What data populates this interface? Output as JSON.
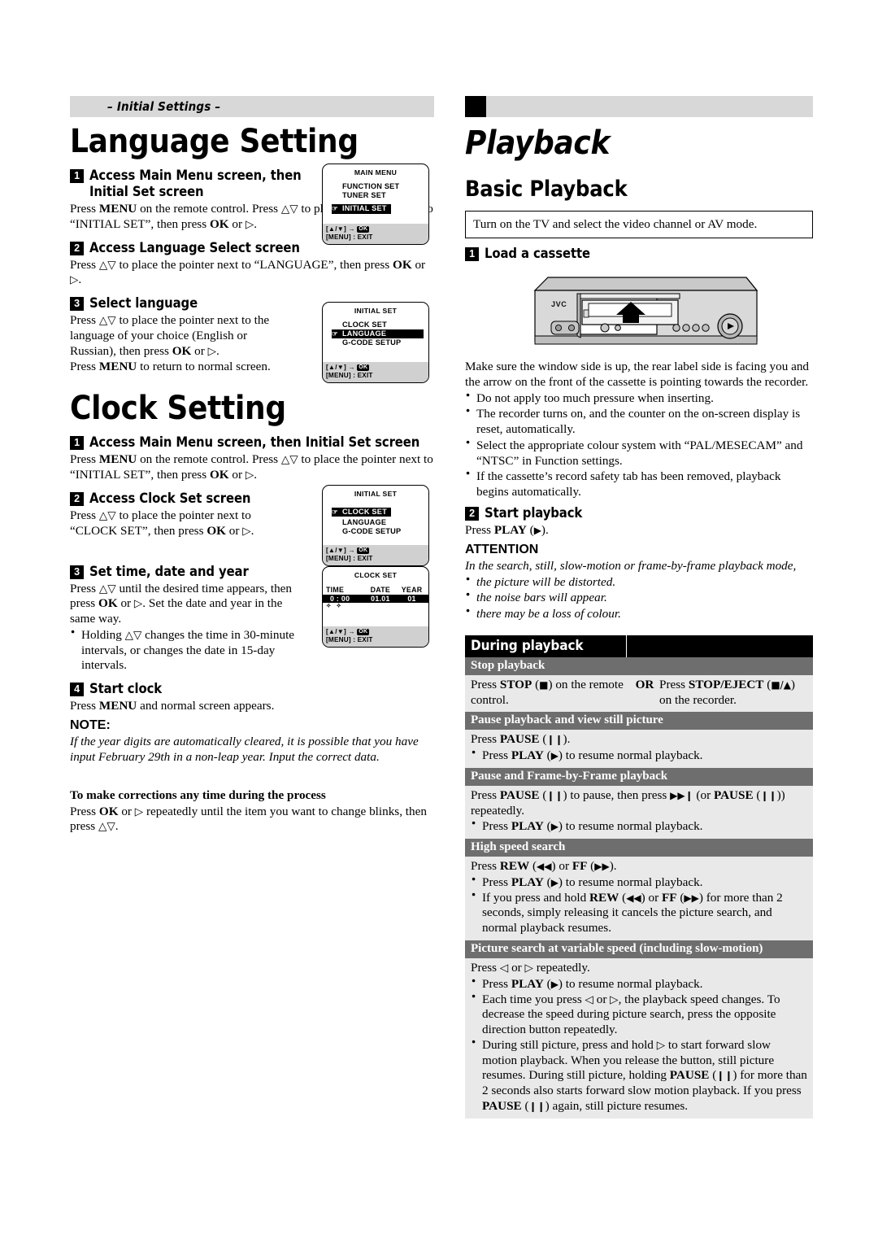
{
  "left": {
    "running_head": "– Initial Settings –",
    "chapter_title": "Language Setting",
    "lang_steps": [
      {
        "num": "1",
        "title_line1": "Access Main Menu screen, then",
        "title_line2": "Initial Set screen",
        "body": "Press MENU on the remote control. Press △▽ to place the pointer next to “INITIAL SET”, then press OK or ▷."
      },
      {
        "num": "2",
        "title_line1": "Access Language Select screen",
        "body": "Press △▽ to place the pointer next to “LANGUAGE”, then press OK or ▷."
      },
      {
        "num": "3",
        "title_line1": "Select language",
        "body": "Press △▽ to place the pointer next to the language of your choice (English or Russian), then press OK or ▷.",
        "body2": "Press MENU to return to normal screen."
      }
    ],
    "clock_title": "Clock Setting",
    "clock_steps": [
      {
        "num": "1",
        "title_line1": "Access Main Menu screen, then Initial Set screen",
        "body": "Press MENU on the remote control. Press △▽ to place the pointer next to “INITIAL SET”, then press OK or ▷."
      },
      {
        "num": "2",
        "title_line1": "Access Clock Set screen",
        "body": "Press △▽ to place the pointer next to “CLOCK SET”, then press OK or ▷."
      },
      {
        "num": "3",
        "title_line1": "Set time, date and year",
        "body": "Press △▽ until the desired time appears, then press OK or ▷. Set the date and year in the same way.",
        "bullets": [
          "Holding △▽ changes the time in 30-minute intervals, or changes the date in 15-day intervals."
        ]
      },
      {
        "num": "4",
        "title_line1": "Start clock",
        "body": "Press MENU and normal screen appears."
      }
    ],
    "note_label": "NOTE:",
    "note_body": "If the year digits are automatically cleared, it is possible that you have input February 29th in a non-leap year. Input the correct data.",
    "corrections_title": "To make corrections any time during the process",
    "corrections_body": "Press OK or ▷ repeatedly until the item you want to change blinks, then press △▽."
  },
  "osd": {
    "main_menu": {
      "title": "MAIN MENU",
      "items": [
        "FUNCTION SET",
        "TUNER SET",
        "INITIAL SET"
      ],
      "selected": "INITIAL SET",
      "foot1": "[▲/▼] →",
      "foot1_key": "OK",
      "foot2": "[MENU] : EXIT"
    },
    "initial_set_language": {
      "title": "INITIAL SET",
      "items": [
        "CLOCK SET",
        "LANGUAGE",
        "G-CODE SETUP"
      ],
      "selected": "LANGUAGE",
      "foot1": "[▲/▼] →",
      "foot1_key": "OK",
      "foot2": "[MENU] : EXIT"
    },
    "initial_set_clock": {
      "title": "INITIAL SET",
      "items": [
        "CLOCK SET",
        "LANGUAGE",
        "G-CODE SETUP"
      ],
      "selected": "CLOCK SET",
      "foot1": "[▲/▼] →",
      "foot1_key": "OK",
      "foot2": "[MENU] : EXIT"
    },
    "clock_set": {
      "title": "CLOCK SET",
      "headers": [
        "TIME",
        "DATE",
        "YEAR"
      ],
      "values": [
        "0 : 00",
        "01.01",
        "01"
      ],
      "foot1": "[▲/▼] →",
      "foot1_key": "OK",
      "foot2": "[MENU] : EXIT"
    }
  },
  "right": {
    "chapter_title": "Playback",
    "section_title": "Basic Playback",
    "notice": "Turn on the TV and select the video channel or AV mode.",
    "steps": [
      {
        "num": "1",
        "title": "Load a cassette",
        "body": "Make sure the window side is up, the rear label side is facing you and the arrow on the front of the cassette is pointing towards the recorder.",
        "bullets": [
          "Do not apply too much pressure when inserting.",
          "The recorder turns on, and the counter on the on-screen display is reset, automatically.",
          "Select the appropriate colour system with “PAL/MESECAM” and “NTSC” in Function settings.",
          "If the cassette’s record safety tab has been removed, playback begins automatically."
        ]
      },
      {
        "num": "2",
        "title": "Start playback",
        "body": "Press PLAY (▶)."
      }
    ],
    "attention_label": "ATTENTION",
    "attention_body": "In the search, still, slow-motion or frame-by-frame playback mode,",
    "attention_bullets": [
      "the picture will be distorted.",
      "the noise bars will appear.",
      "there may be a loss of colour."
    ],
    "vcr_brand": "JVC"
  },
  "table": {
    "title": "During playback",
    "rows": [
      {
        "head": "Stop playback",
        "type": "two-col",
        "left": "Press STOP (■) on the remote control.",
        "or": "OR",
        "right": "Press STOP/EJECT (■/▲) on the recorder."
      },
      {
        "head": "Pause playback and view still picture",
        "type": "simple",
        "body": "Press PAUSE (❙❙).",
        "bullets": [
          "Press PLAY (▶) to resume normal playback."
        ]
      },
      {
        "head": "Pause and Frame-by-Frame playback",
        "type": "simple",
        "body": "Press PAUSE (❙❙) to pause, then press ▶▶❙ (or PAUSE (❙❙)) repeatedly.",
        "bullets": [
          "Press PLAY (▶) to resume normal playback."
        ]
      },
      {
        "head": "High speed search",
        "type": "simple",
        "body": "Press REW (◀◀) or FF (▶▶).",
        "bullets": [
          "Press PLAY (▶) to resume normal playback.",
          "If you press and hold REW (◀◀) or FF (▶▶) for more than 2 seconds, simply releasing it cancels the picture search, and normal playback resumes."
        ]
      },
      {
        "head": "Picture search at variable speed (including slow-motion)",
        "type": "simple",
        "body": "Press ◁ or ▷ repeatedly.",
        "bullets": [
          "Press PLAY (▶) to resume normal playback.",
          "Each time you press ◁ or ▷, the playback speed changes. To decrease the speed during picture search, press the opposite direction button repeatedly.",
          "During still picture, press and hold ▷ to start forward slow motion playback. When you release the button, still picture resumes. During still picture, holding PAUSE (❙❙) for more than 2 seconds also starts forward slow motion playback. If you press PAUSE (❙❙) again, still picture resumes."
        ]
      }
    ]
  }
}
